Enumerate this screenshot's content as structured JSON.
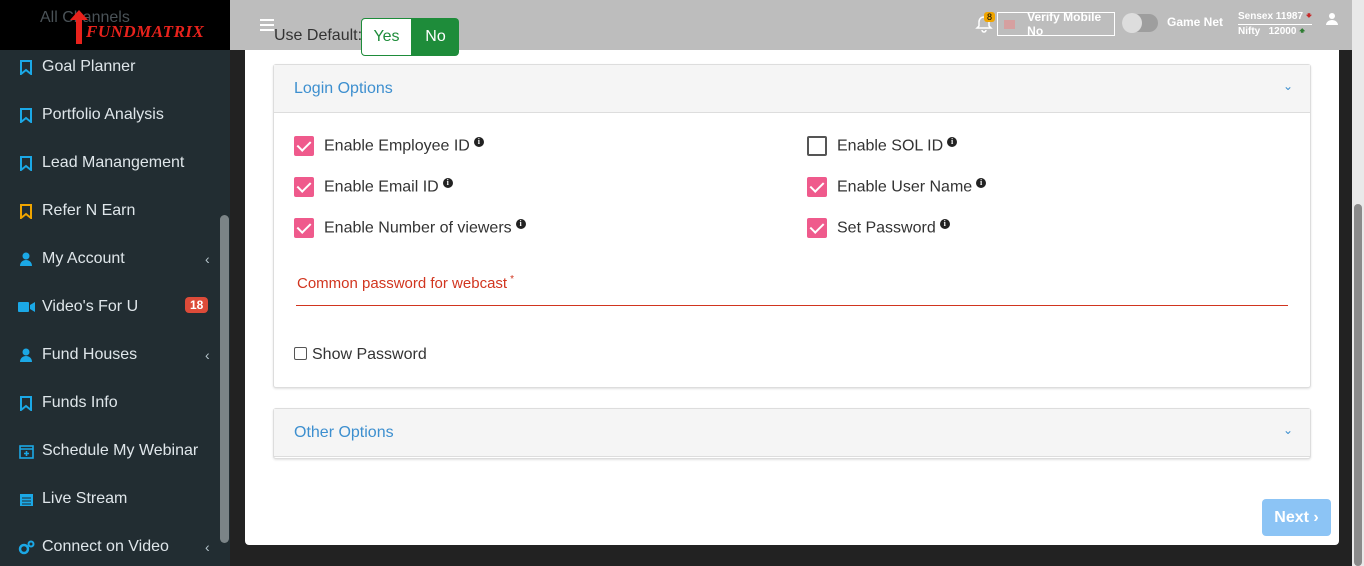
{
  "app": {
    "logo_text": "FUNDMATRIX",
    "ghost_text": "All Channels"
  },
  "sidebar": {
    "items": [
      {
        "label": "Goal Planner",
        "icon": "bookmark-icon"
      },
      {
        "label": "Portfolio Analysis",
        "icon": "bookmark-icon"
      },
      {
        "label": "Lead Manangement",
        "icon": "bookmark-icon"
      },
      {
        "label": "Refer N Earn",
        "icon": "bookmark-icon"
      },
      {
        "label": "My Account",
        "icon": "user-icon"
      },
      {
        "label": "Video's For U",
        "icon": "video-icon",
        "badge": "18"
      },
      {
        "label": "Fund Houses",
        "icon": "user-icon"
      },
      {
        "label": "Funds Info",
        "icon": "bookmark-icon"
      },
      {
        "label": "Schedule My Webinar",
        "icon": "calendar-plus-icon"
      },
      {
        "label": "Live Stream",
        "icon": "calendar-icon"
      },
      {
        "label": "Connect on Video",
        "icon": "cogs-icon"
      }
    ]
  },
  "topbar": {
    "notification_count": "8",
    "verify_label": "Verify Mobile No",
    "game_net_label": "Game Net",
    "sensex": "Sensex 11987",
    "nifty": "Nifty",
    "nifty_value": "12000"
  },
  "form": {
    "use_default_label": "Use Default:",
    "yes_label": "Yes",
    "no_label": "No",
    "selected": "No",
    "login_options_title": "Login Options",
    "other_options_title": "Other Options",
    "options": [
      {
        "label": "Enable Employee ID",
        "checked": true
      },
      {
        "label": "Enable SOL ID",
        "checked": false
      },
      {
        "label": "Enable Email ID",
        "checked": true
      },
      {
        "label": "Enable User Name",
        "checked": true
      },
      {
        "label": "Enable Number of viewers",
        "checked": true
      },
      {
        "label": "Set Password",
        "checked": true
      }
    ],
    "password_label": "Common password for webcast",
    "required_mark": "*",
    "password_value": "",
    "show_password_label": "Show Password",
    "show_password_checked": false,
    "next_label": "Next"
  },
  "colors": {
    "accent_green": "#1e8c3a",
    "checkbox_pink": "#ef5a8c",
    "link_blue": "#3d8fcf",
    "error_red": "#d1351f",
    "next_button": "#8cc4f5"
  }
}
